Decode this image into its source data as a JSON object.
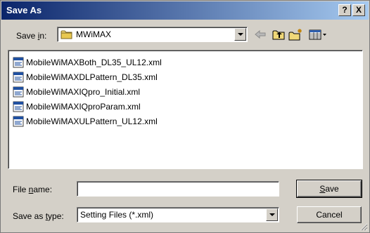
{
  "window": {
    "title": "Save As",
    "help_glyph": "?",
    "close_glyph": "X"
  },
  "save_in": {
    "label_pre": "Save ",
    "label_access": "i",
    "label_post": "n:",
    "value": "MWiMAX"
  },
  "toolbar": {
    "icons": [
      "back-arrow-icon",
      "up-folder-icon",
      "new-folder-icon",
      "views-menu-icon"
    ]
  },
  "files": [
    "MobileWiMAXBoth_DL35_UL12.xml",
    "MobileWiMAXDLPattern_DL35.xml",
    "MobileWiMAXIQpro_Initial.xml",
    "MobileWiMAXIQproParam.xml",
    "MobileWiMAXULPattern_UL12.xml"
  ],
  "file_name": {
    "label_pre": "File ",
    "label_access": "n",
    "label_post": "ame:",
    "value": ""
  },
  "file_type": {
    "label_pre": "Save as ",
    "label_access": "t",
    "label_post": "ype:",
    "value": "Setting Files (*.xml)"
  },
  "buttons": {
    "save_access": "S",
    "save_rest": "ave",
    "cancel": "Cancel"
  },
  "colors": {
    "titlebar_start": "#0a246a",
    "titlebar_end": "#a6caf0",
    "dialog_face": "#d4d0c8"
  }
}
